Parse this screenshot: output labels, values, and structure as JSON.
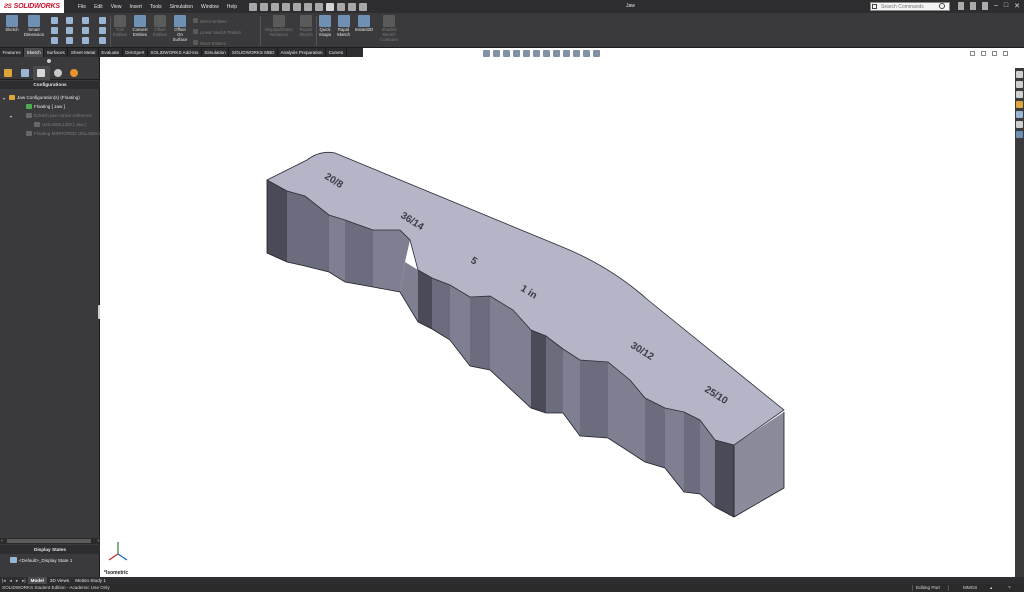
{
  "app": {
    "brand": "SOLIDWORKS",
    "document_title": "Jaw",
    "search_placeholder": "Search Commands"
  },
  "menu": [
    "File",
    "Edit",
    "View",
    "Insert",
    "Tools",
    "Simulation",
    "Window",
    "Help"
  ],
  "commands": {
    "sketch": "Sketch",
    "smart_dimension": [
      "Smart",
      "Dimension"
    ],
    "trim_entities": [
      "Trim",
      "Entities"
    ],
    "convert_entities": [
      "Convert",
      "Entities"
    ],
    "offset_entities": [
      "Offset",
      "Entities"
    ],
    "offset_on_surface": [
      "Offset",
      "On",
      "Surface"
    ],
    "mirror_entities": "Mirror Entities",
    "linear_sketch_pattern": "Linear Sketch Pattern",
    "move_entities": "Move Entities",
    "display_delete_relations": [
      "Display/Delete",
      "Relations"
    ],
    "repair_sketch": [
      "Repair",
      "Sketch"
    ],
    "quick_snaps": [
      "Quick",
      "Snaps"
    ],
    "rapid_sketch": [
      "Rapid",
      "Sketch"
    ],
    "instant2d": "Instant2D",
    "shaded_sketch_contours": [
      "Shaded",
      "Sketch",
      "Contours"
    ]
  },
  "tabs": [
    "Features",
    "Sketch",
    "Surfaces",
    "Sheet Metal",
    "Evaluate",
    "DimXpert",
    "SOLIDWORKS Add-Ins",
    "Simulation",
    "SOLIDWORKS MBD",
    "Analysis Preparation",
    "Curves"
  ],
  "active_tab": "Sketch",
  "left_panel": {
    "header": "Configurations",
    "tree": [
      {
        "label": "Jaw Configuration(s)  (Floating)",
        "dim": false
      },
      {
        "label": "Floating [ Jaw ]",
        "dim": false
      },
      {
        "label": "Ecksch jaw corner reference",
        "dim": true
      },
      {
        "label": "UNLABELLED [ Jaw ]",
        "dim": true
      },
      {
        "label": "Floating MIRRORED UNLABELLED",
        "dim": true
      }
    ],
    "display_states_header": "Display States",
    "display_state_item": "<Default>_Display State 1"
  },
  "viewport": {
    "view_orientation": "*Isometric",
    "engravings": [
      "20/8",
      "36/14",
      "5",
      "1 in",
      "30/12",
      "25/10"
    ]
  },
  "bottom_tabs": [
    "Model",
    "3D Views",
    "Motion Study 1"
  ],
  "active_bottom_tab": "Model",
  "status": {
    "left": "SOLIDWORKS Student Edition - Academic Use Only",
    "mode": "Editing Part",
    "units": "MMGS"
  },
  "colors": {
    "accent_red": "#c8102e",
    "ui_dark": "#2d2d2f",
    "ui_mid": "#3a3a3c",
    "part_top": "#b4b6c8",
    "part_side": "#7f8092"
  }
}
